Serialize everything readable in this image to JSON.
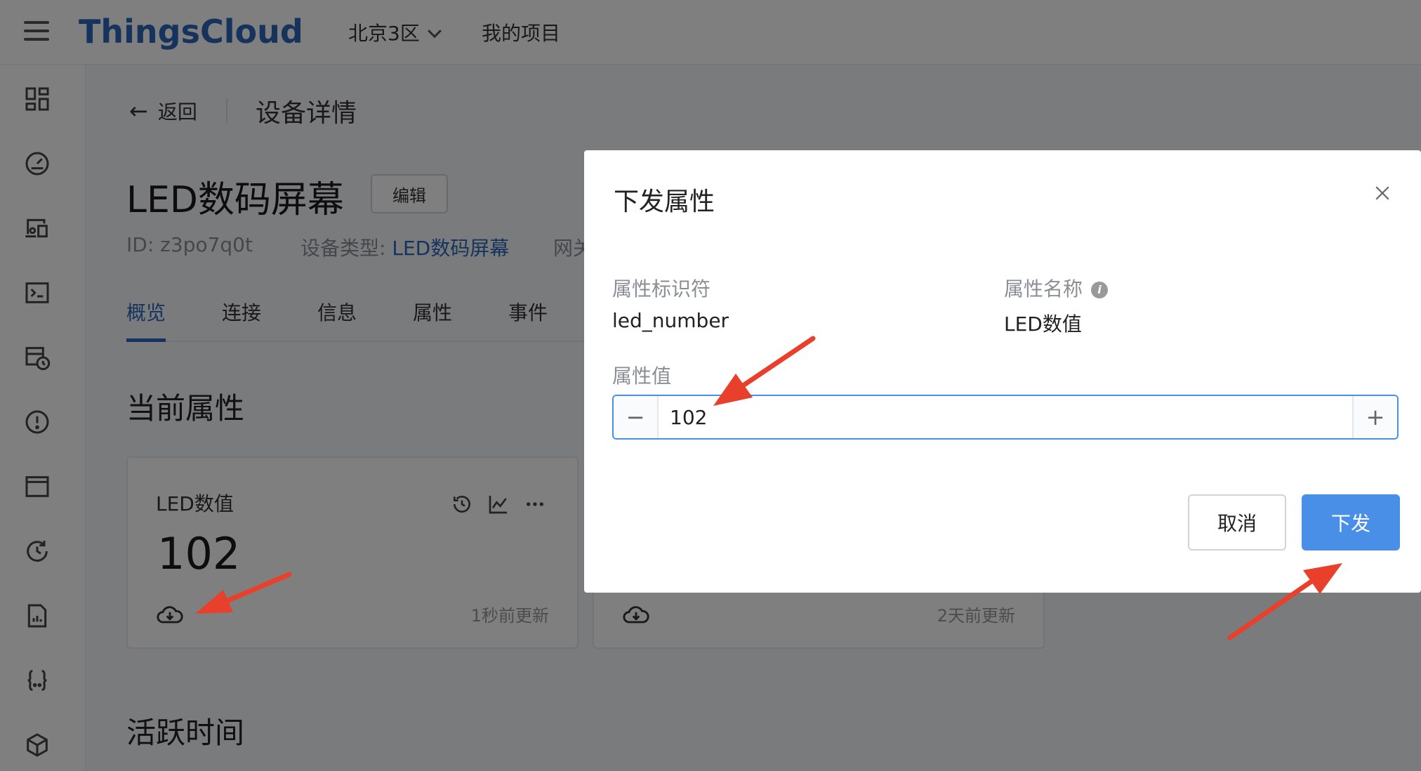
{
  "header": {
    "logo": "ThingsCloud",
    "region": "北京3区",
    "project": "我的项目"
  },
  "sidebar": {
    "icons": [
      "dashboard-icon",
      "gauge-icon",
      "devices-icon",
      "terminal-icon",
      "schedule-icon",
      "alert-icon",
      "window-icon",
      "history-icon",
      "report-icon",
      "code-icon",
      "package-icon"
    ]
  },
  "page": {
    "back_label": "返回",
    "title": "设备详情",
    "device_name": "LED数码屏幕",
    "edit_label": "编辑",
    "id_text": "ID: z3po7q0t",
    "type_label": "设备类型:",
    "type_value": "LED数码屏幕",
    "gateway_partial": "网关",
    "tabs": [
      "概览",
      "连接",
      "信息",
      "属性",
      "事件"
    ],
    "current_props_title": "当前属性",
    "active_time_title": "活跃时间",
    "cards": [
      {
        "name": "LED数值",
        "value": "102",
        "updated": "1秒前更新"
      },
      {
        "name": "",
        "value": "",
        "updated": "2天前更新"
      }
    ]
  },
  "modal": {
    "title": "下发属性",
    "identifier_label": "属性标识符",
    "identifier_value": "led_number",
    "name_label": "属性名称",
    "name_value": "LED数值",
    "value_label": "属性值",
    "value": "102",
    "cancel_label": "取消",
    "submit_label": "下发"
  },
  "colors": {
    "brand": "#2b66b8",
    "primary_button": "#4a8fe7",
    "annotation_arrow": "#e8402a"
  }
}
